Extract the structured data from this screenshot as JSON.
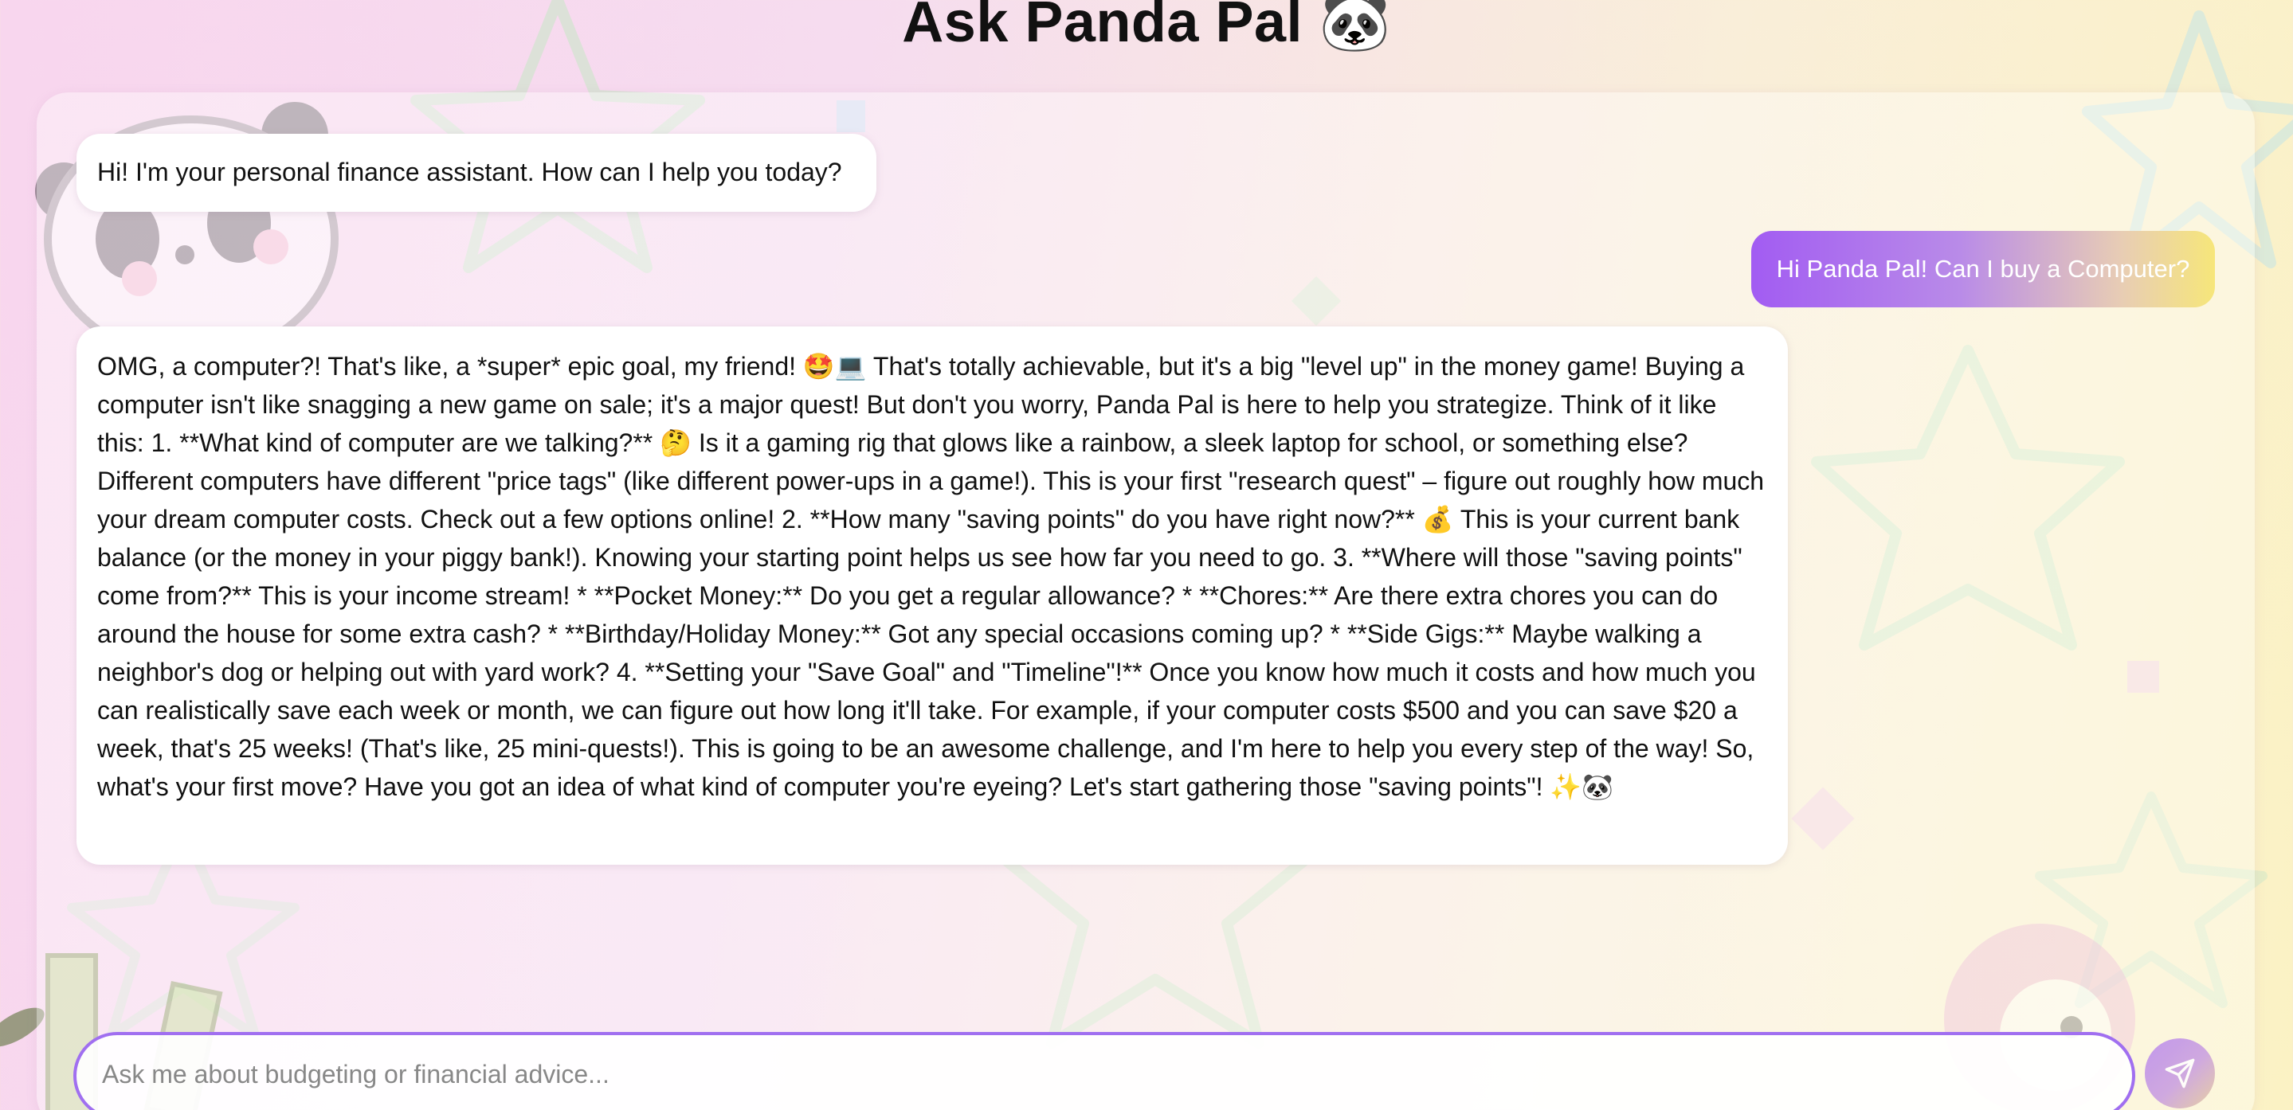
{
  "header": {
    "title": "Ask Panda Pal 🐼"
  },
  "chat": {
    "messages": [
      {
        "role": "assistant",
        "text": "Hi! I'm your personal finance assistant. How can I help you today?"
      },
      {
        "role": "user",
        "text": "Hi Panda Pal! Can I buy a Computer?"
      },
      {
        "role": "assistant",
        "text": "OMG, a computer?! That's like, a *super* epic goal, my friend! 🤩💻 That's totally achievable, but it's a big \"level up\" in the money game! Buying a computer isn't like snagging a new game on sale; it's a major quest! But don't you worry, Panda Pal is here to help you strategize. Think of it like this: 1. **What kind of computer are we talking?** 🤔 Is it a gaming rig that glows like a rainbow, a sleek laptop for school, or something else? Different computers have different \"price tags\" (like different power-ups in a game!). This is your first \"research quest\" – figure out roughly how much your dream computer costs. Check out a few options online! 2. **How many \"saving points\" do you have right now?** 💰 This is your current bank balance (or the money in your piggy bank!). Knowing your starting point helps us see how far you need to go. 3. **Where will those \"saving points\" come from?** This is your income stream! * **Pocket Money:** Do you get a regular allowance? * **Chores:** Are there extra chores you can do around the house for some extra cash? * **Birthday/Holiday Money:** Got any special occasions coming up? * **Side Gigs:** Maybe walking a neighbor's dog or helping out with yard work? 4. **Setting your \"Save Goal\" and \"Timeline\"!** Once you know how much it costs and how much you can realistically save each week or month, we can figure out how long it'll take. For example, if your computer costs $500 and you can save $20 a week, that's 25 weeks! (That's like, 25 mini-quests!). This is going to be an awesome challenge, and I'm here to help you every step of the way! So, what's your first move? Have you got an idea of what kind of computer you're eyeing? Let's start gathering those \"saving points\"! ✨🐼"
      }
    ]
  },
  "composer": {
    "placeholder": "Ask me about budgeting or financial advice...",
    "value": "",
    "send_icon": "send-icon"
  },
  "colors": {
    "accent": "#a25cf2",
    "user_bubble_end": "#f6e67a",
    "background_pink": "#f8d6ee",
    "background_yellow": "#fbf2c4"
  }
}
